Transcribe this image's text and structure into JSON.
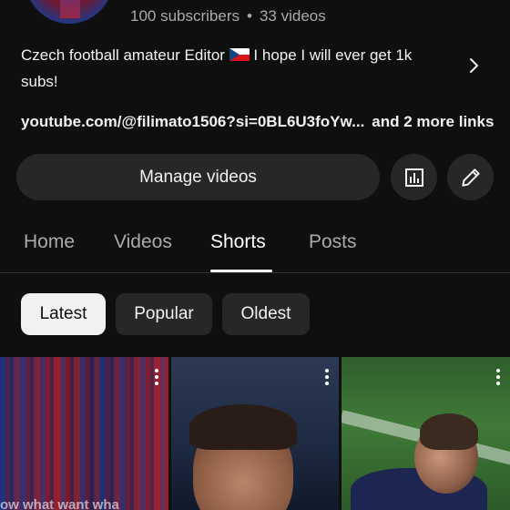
{
  "channel": {
    "subscribers": "100 subscribers",
    "separator": "•",
    "videos": "33 videos"
  },
  "description": {
    "text_before_flag": "Czech football amateur Editor",
    "flag": "czech-flag",
    "text_after_flag": "I hope I will ever get 1k subs!"
  },
  "links": {
    "url": "youtube.com/@filimato1506?si=0BL6U3foYw...",
    "more": "and 2 more links"
  },
  "actions": {
    "manage_label": "Manage videos",
    "analytics_icon": "analytics-icon",
    "edit_icon": "edit-pencil-icon"
  },
  "tabs": [
    {
      "label": "Home",
      "active": false
    },
    {
      "label": "Videos",
      "active": false
    },
    {
      "label": "Shorts",
      "active": true
    },
    {
      "label": "Posts",
      "active": false
    }
  ],
  "filters": [
    {
      "label": "Latest",
      "selected": true
    },
    {
      "label": "Popular",
      "selected": false
    },
    {
      "label": "Oldest",
      "selected": false
    }
  ],
  "shorts": [
    {
      "caption": "ow what want wha"
    },
    {
      "caption": ""
    },
    {
      "caption": ""
    }
  ],
  "colors": {
    "background": "#0f0f0f",
    "surface": "#272727",
    "text": "#f1f1f1",
    "muted": "#aaaaaa",
    "chip_selected": "#f1f1f1"
  }
}
